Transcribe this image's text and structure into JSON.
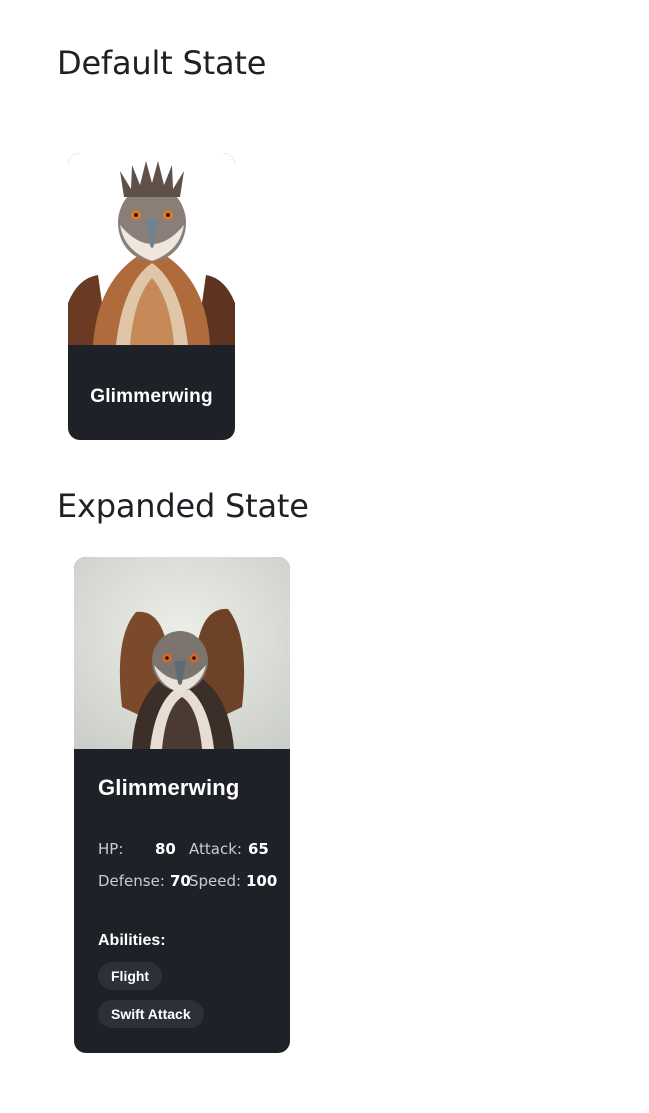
{
  "sections": {
    "default_title": "Default State",
    "expanded_title": "Expanded State"
  },
  "creature": {
    "name": "Glimmerwing",
    "image_icon": "eagle-portrait-image",
    "stats": {
      "hp_label": "HP:",
      "hp_value": "80",
      "attack_label": "Attack:",
      "attack_value": "65",
      "defense_label": "Defense:",
      "defense_value": "70",
      "speed_label": "Speed:",
      "speed_value": "100"
    },
    "abilities_heading": "Abilities:",
    "abilities": [
      "Flight",
      "Swift Attack"
    ]
  },
  "colors": {
    "card_background": "#1f2128",
    "pill_background": "#2d3039",
    "heading_text": "#1e2025"
  }
}
